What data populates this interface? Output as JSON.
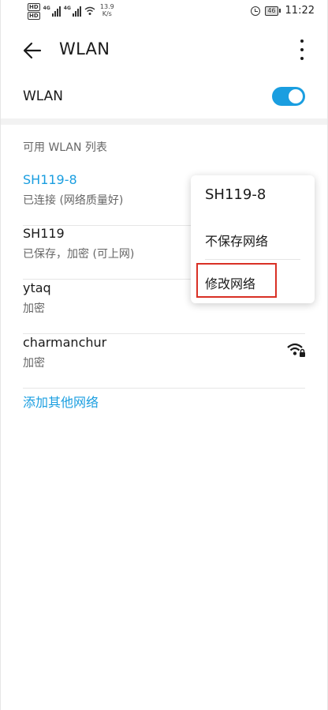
{
  "status_bar": {
    "hd1": "HD",
    "hd2": "HD",
    "net1": "4G",
    "net2": "4G",
    "speed_value": "13.9",
    "speed_unit": "K/s",
    "battery": "46",
    "time": "11:22"
  },
  "header": {
    "title": "WLAN",
    "back_icon": "arrow-left-icon",
    "more_icon": "more-vertical-icon"
  },
  "wlan_toggle": {
    "label": "WLAN",
    "enabled": true,
    "accent_color": "#1a9ee0"
  },
  "networks": {
    "title": "可用 WLAN 列表",
    "items": [
      {
        "ssid": "SH119-8",
        "status": "已连接 (网络质量好)",
        "connected": true,
        "icon": "wifi-lock-icon"
      },
      {
        "ssid": "SH119",
        "status": "已保存，加密 (可上网)",
        "connected": false,
        "icon": "wifi-lock-icon"
      },
      {
        "ssid": "ytaq",
        "status": "加密",
        "connected": false,
        "icon": "wifi-lock-icon"
      },
      {
        "ssid": "charmanchur",
        "status": "加密",
        "connected": false,
        "icon": "wifi-lock-icon"
      }
    ],
    "add_other": "添加其他网络"
  },
  "popup": {
    "title": "SH119-8",
    "forget": "不保存网络",
    "modify": "修改网络",
    "highlight_color": "#d93025"
  }
}
